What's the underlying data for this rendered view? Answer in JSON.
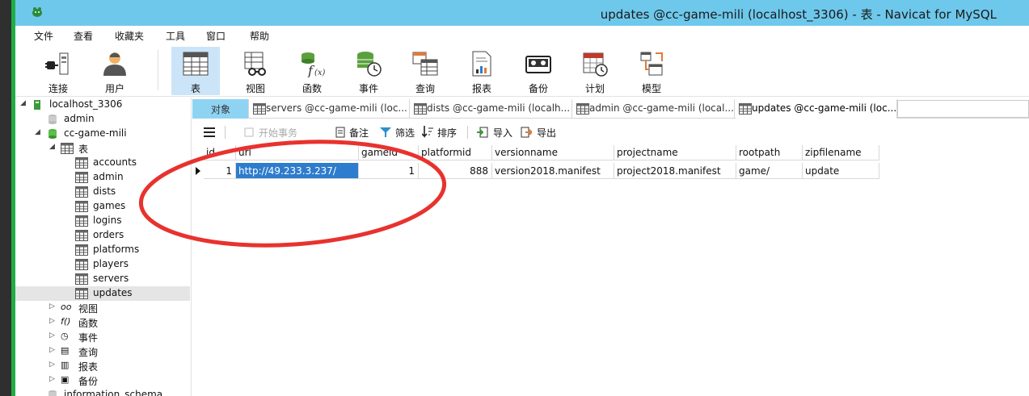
{
  "window": {
    "title": "updates @cc-game-mili (localhost_3306) - 表 - Navicat for MySQL"
  },
  "menu": [
    "文件",
    "查看",
    "收藏夹",
    "工具",
    "窗口",
    "帮助"
  ],
  "toolbar": [
    {
      "label": "连接",
      "icon": "plug-icon",
      "active": false
    },
    {
      "label": "用户",
      "icon": "user-icon",
      "active": false
    },
    {
      "label": "表",
      "icon": "table-icon",
      "active": true
    },
    {
      "label": "视图",
      "icon": "view-icon",
      "active": false
    },
    {
      "label": "函数",
      "icon": "function-icon",
      "active": false
    },
    {
      "label": "事件",
      "icon": "event-icon",
      "active": false
    },
    {
      "label": "查询",
      "icon": "query-icon",
      "active": false
    },
    {
      "label": "报表",
      "icon": "report-icon",
      "active": false
    },
    {
      "label": "备份",
      "icon": "backup-icon",
      "active": false
    },
    {
      "label": "计划",
      "icon": "schedule-icon",
      "active": false
    },
    {
      "label": "模型",
      "icon": "model-icon",
      "active": false
    }
  ],
  "navigator": {
    "connection": "localhost_3306",
    "databases": {
      "admin": "admin",
      "current": "cc-game-mili",
      "tables_node": "表",
      "tables": [
        "accounts",
        "admin",
        "dists",
        "games",
        "logins",
        "orders",
        "platforms",
        "players",
        "servers",
        "updates"
      ],
      "selected_table": "updates",
      "other_nodes": [
        "视图",
        "函数",
        "事件",
        "查询",
        "报表",
        "备份"
      ],
      "next_db": "information_schema"
    }
  },
  "tabs": {
    "objects": "对象",
    "open": [
      "servers @cc-game-mili (loc...",
      "dists @cc-game-mili (localh...",
      "admin @cc-game-mili (local...",
      "updates @cc-game-mili (loc..."
    ],
    "active_index": 3
  },
  "grid_toolbar": {
    "begin_transaction": "开始事务",
    "memo": "备注",
    "filter": "筛选",
    "sort": "排序",
    "import": "导入",
    "export": "导出"
  },
  "table": {
    "columns": [
      "id",
      "url",
      "gameid",
      "platformid",
      "versionname",
      "projectname",
      "rootpath",
      "zipfilename"
    ],
    "rows": [
      [
        "1",
        "http://49.233.3.237/",
        "1",
        "888",
        "version2018.manifest",
        "project2018.manifest",
        "game/",
        "update"
      ]
    ]
  },
  "colors": {
    "titlebar": "#6ec8ec",
    "objects_tab": "#8fd3f3",
    "selection": "#2d7ccd",
    "annotation": "#e8322e"
  }
}
